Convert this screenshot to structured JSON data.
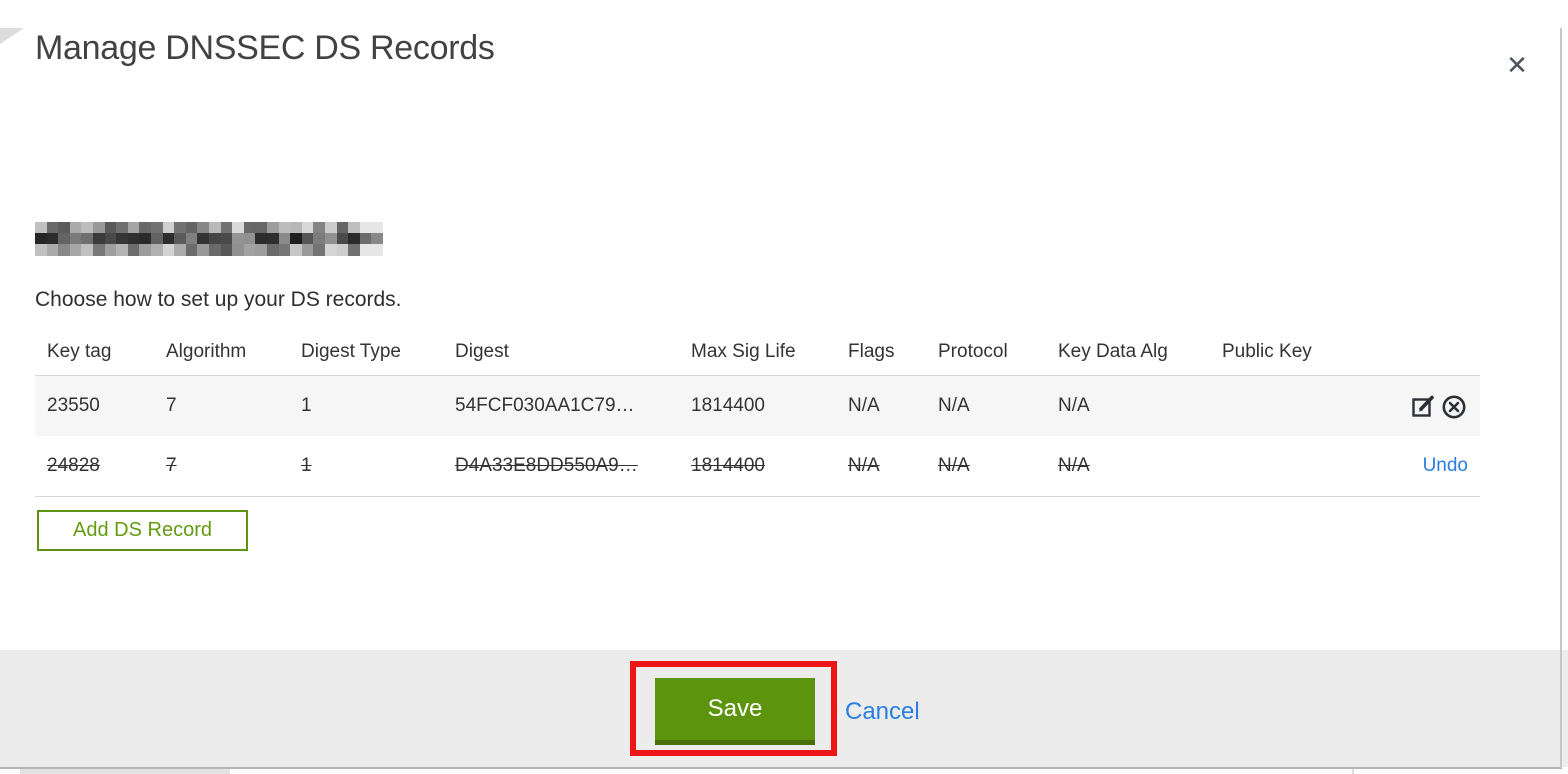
{
  "modal": {
    "title": "Manage DNSSEC DS Records",
    "instruction": "Choose how to set up your DS records.",
    "domain": {
      "redacted": true
    },
    "table": {
      "headers": [
        "Key tag",
        "Algorithm",
        "Digest Type",
        "Digest",
        "Max Sig Life",
        "Flags",
        "Protocol",
        "Key Data Alg",
        "Public Key"
      ],
      "rows": [
        {
          "key_tag": "23550",
          "algorithm": "7",
          "digest_type": "1",
          "digest": "54FCF030AA1C79…",
          "max_sig_life": "1814400",
          "flags": "N/A",
          "protocol": "N/A",
          "key_data_alg": "N/A",
          "public_key": "",
          "state": "active"
        },
        {
          "key_tag": "24828",
          "algorithm": "7",
          "digest_type": "1",
          "digest": "D4A33E8DD550A9…",
          "max_sig_life": "1814400",
          "flags": "N/A",
          "protocol": "N/A",
          "key_data_alg": "N/A",
          "public_key": "",
          "state": "marked-for-deletion",
          "undo_label": "Undo"
        }
      ]
    },
    "buttons": {
      "add_ds_record": "Add DS Record",
      "save": "Save",
      "cancel": "Cancel"
    },
    "icons": {
      "close": "✕",
      "edit": "pencil-in-square",
      "remove": "circle-x"
    },
    "colors": {
      "save_green": "#5d940e",
      "save_green_dark": "#486f0b",
      "outline_green": "#5e9210",
      "link_blue": "#2a7de1",
      "annotation_red": "#ee1516",
      "footer_bg": "#ececec",
      "row_stripe": "#f6f6f6"
    },
    "annotation": {
      "type": "highlight-rectangle",
      "target": "save-button"
    }
  }
}
